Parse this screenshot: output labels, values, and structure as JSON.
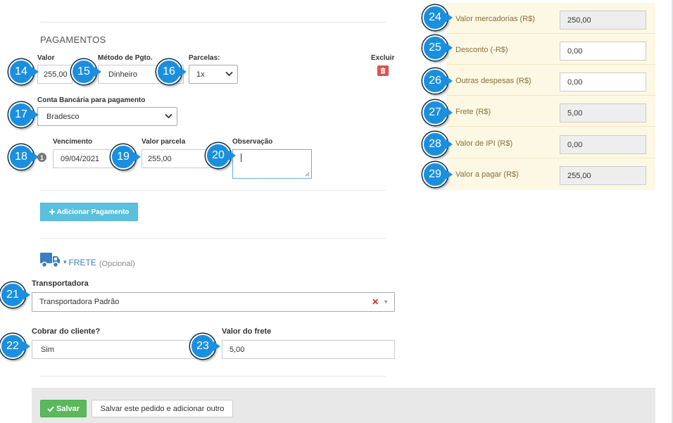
{
  "pagamentos": {
    "title": "PAGAMENTOS",
    "valor_label": "Valor",
    "valor_value": "255,00",
    "metodo_label": "Método de Pgto.",
    "metodo_value": "Dinheiro",
    "parcelas_label": "Parcelas:",
    "parcelas_value": "1x",
    "excluir_label": "Excluir",
    "conta_label": "Conta Bancária para pagamento",
    "conta_value": "Bradesco",
    "installment_number": "1",
    "vencimento_label": "Vencimento",
    "vencimento_value": "09/04/2021",
    "valor_parcela_label": "Valor parcela",
    "valor_parcela_value": "255,00",
    "observacao_label": "Observação",
    "observacao_value": "",
    "add_button": "Adicionar Pagamento"
  },
  "frete": {
    "title": "FRETE",
    "optional": "(Opcional)",
    "transportadora_label": "Transportadora",
    "transportadora_value": "Transportadora Padrão",
    "cobrar_label": "Cobrar do cliente?",
    "cobrar_value": "Sim",
    "valor_frete_label": "Valor do frete",
    "valor_frete_value": "5,00"
  },
  "summary": [
    {
      "label": "Valor mercadorias (R$)",
      "value": "250,00",
      "readonly": true
    },
    {
      "label": "Desconto (-R$)",
      "value": "0,00",
      "readonly": false
    },
    {
      "label": "Outras despesas (R$)",
      "value": "0,00",
      "readonly": false
    },
    {
      "label": "Frete (R$)",
      "value": "5,00",
      "readonly": true
    },
    {
      "label": "Valor de IPI (R$)",
      "value": "0,00",
      "readonly": true
    },
    {
      "label": "Valor a pagar (R$)",
      "value": "255,00",
      "readonly": true
    }
  ],
  "footer": {
    "save_label": "Salvar",
    "save_add_label": "Salvar este pedido e adicionar outro"
  },
  "callouts": [
    "14",
    "15",
    "16",
    "17",
    "18",
    "19",
    "20",
    "21",
    "22",
    "23",
    "24",
    "25",
    "26",
    "27",
    "28",
    "29"
  ],
  "colors": {
    "callout": "#1a8fe0",
    "summary_bg": "#fcf8e3",
    "summary_label": "#8a6d3b",
    "add_button": "#5bc0de",
    "save_button": "#5cb85c",
    "delete_button": "#d9534f",
    "truck_icon": "#3a7fc1"
  },
  "icons": {
    "delete": "trash-icon",
    "add": "plus-icon",
    "save": "check-icon",
    "truck": "truck-icon",
    "clear": "close-icon",
    "dropdown": "chevron-down-icon"
  }
}
